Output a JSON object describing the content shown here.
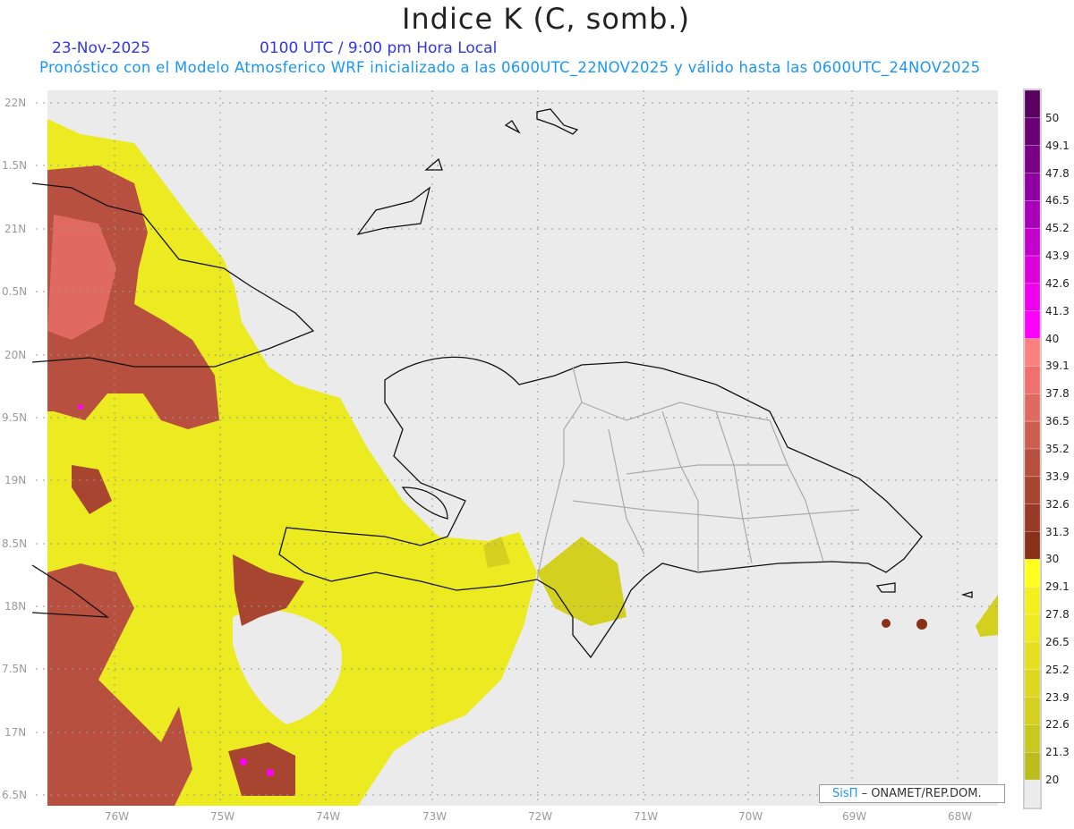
{
  "header": {
    "title": "Indice K (C, somb.)",
    "date": "23-Nov-2025",
    "time": "0100 UTC / 9:00 pm Hora Local",
    "description": "Pronóstico con el Modelo Atmosferico WRF inicializado a las 0600UTC_22NOV2025 y válido hasta las  0600UTC_24NOV2025"
  },
  "map": {
    "lat_labels": [
      "22N",
      "1.5N",
      "21N",
      "0.5N",
      "20N",
      "9.5N",
      "19N",
      "8.5N",
      "18N",
      "7.5N",
      "17N",
      "6.5N"
    ],
    "lon_labels": [
      "76W",
      "75W",
      "74W",
      "73W",
      "72W",
      "71W",
      "70W",
      "69W",
      "68W"
    ],
    "background_color": "#ebebeb",
    "credit": {
      "brand": "SisΠ",
      "text": "– ONAMET/REP.DOM."
    }
  },
  "colorbar": {
    "labels": [
      "50",
      "49.1",
      "47.8",
      "46.5",
      "45.2",
      "43.9",
      "42.6",
      "41.3",
      "40",
      "39.1",
      "37.8",
      "36.5",
      "35.2",
      "33.9",
      "32.6",
      "31.3",
      "30",
      "29.1",
      "27.8",
      "26.5",
      "25.2",
      "23.9",
      "22.6",
      "21.3",
      "20"
    ],
    "colors": [
      "#5a0060",
      "#6a0075",
      "#7a0088",
      "#9000a0",
      "#a800b8",
      "#c400cc",
      "#dc00dc",
      "#ee00ee",
      "#ff00ff",
      "#ff8080",
      "#f07070",
      "#e06a60",
      "#cc5e50",
      "#b85040",
      "#a84530",
      "#983a25",
      "#883018",
      "#ffff20",
      "#f4f020",
      "#ecea20",
      "#e4e020",
      "#dcd820",
      "#d4d020",
      "#c8c81e",
      "#bcbc1c",
      "#ebebeb"
    ]
  }
}
